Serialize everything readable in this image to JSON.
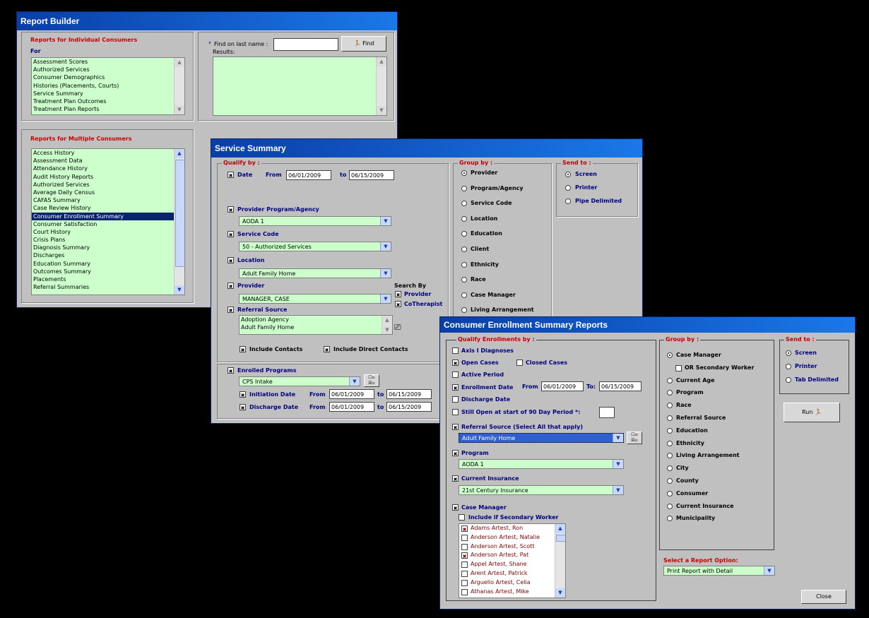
{
  "report_builder": {
    "title": "Report Builder",
    "individual": {
      "heading": "Reports for Individual Consumers",
      "for_label": "For",
      "items": [
        "Assessment Scores",
        "Authorized Services",
        "Consumer Demographics",
        "Histories (Placements, Courts)",
        "Service Summary",
        "Treatment Plan Outcomes",
        "Treatment Plan Reports"
      ]
    },
    "find": {
      "label": "Find on last name :",
      "value": "",
      "button": "Find",
      "results_label": "Results:"
    },
    "multiple": {
      "heading": "Reports for Multiple Consumers",
      "items": [
        "Access History",
        "Assessment Data",
        "Attendance History",
        "Audit History Reports",
        "Authorized Services",
        "Average Daily Census",
        "CAFAS Summary",
        "Case Review History",
        "Consumer Enrollment Summary",
        "Consumer Satisfaction",
        "Court History",
        "Crisis Plans",
        "Diagnosis Summary",
        "Discharges",
        "Education Summary",
        "Outcomes Summary",
        "Placements",
        "Referral Summaries"
      ],
      "selected": "Consumer Enrollment Summary"
    }
  },
  "service_summary": {
    "title": "Service Summary",
    "qualify_label": "Qualify by :",
    "date_label": "Date",
    "from_label": "From",
    "to_label": "to",
    "date_from": "06/01/2009",
    "date_to": "06/15/2009",
    "provider_program_label": "Provider Program/Agency",
    "provider_program_value": "AODA 1",
    "service_code_label": "Service Code",
    "service_code_value": "50 - Authorized Services",
    "location_label": "Location",
    "location_value": "Adult Family Home",
    "provider_label": "Provider",
    "provider_value": "MANAGER, CASE",
    "search_by_label": "Search By",
    "search_by_provider": "Provider",
    "search_by_cotherapist": "CoTherapist",
    "referral_label": "Referral Source",
    "referral_items": [
      "Adoption Agency",
      "Adult Family Home"
    ],
    "include_contacts": "Include Contacts",
    "include_direct_contacts": "Include Direct Contacts",
    "enrolled_label": "Enrolled Programs",
    "enrolled_value": "CPS Intake",
    "initiation_label": "Initiation Date",
    "initiation_from": "06/01/2009",
    "initiation_to": "06/15/2009",
    "discharge_label": "Discharge Date",
    "discharge_from": "06/01/2009",
    "discharge_to": "06/15/2009",
    "from_cap": "From",
    "group_label": "Group by :",
    "group_items": [
      "Provider",
      "Program/Agency",
      "Service Code",
      "Location",
      "Education",
      "Client",
      "Ethnicity",
      "Race",
      "Case Manager",
      "Living Arrangement"
    ],
    "send_label": "Send to :",
    "send_items": [
      "Screen",
      "Printer",
      "Pipe Delimited"
    ]
  },
  "enrollment": {
    "title": "Consumer Enrollment Summary Reports",
    "qualify_label": "Qualify Enrollments by :",
    "axis": "Axis I Diagnoses",
    "open_cases": "Open Cases",
    "closed_cases": "Closed Cases",
    "active_period": "Active Period",
    "enrollment_date": "Enrollment Date",
    "from_label": "From",
    "to_label": "To:",
    "enroll_from": "06/01/2009",
    "enroll_to": "06/15/2009",
    "discharge_date": "Discharge Date",
    "still_open": "Still Open at start of 90 Day Period *:",
    "still_open_value": "",
    "referral_label": "Referral Source (Select All that apply)",
    "referral_value": "Adult Family Home",
    "program_label": "Program",
    "program_value": "AODA 1",
    "insurance_label": "Current Insurance",
    "insurance_value": "21st Century Insurance",
    "case_manager_label": "Case Manager",
    "include_secondary": "Include if Secondary Worker",
    "managers": [
      {
        "name": "Adams Artest, Ron",
        "checked": true
      },
      {
        "name": "Anderson Artest, Natalie",
        "checked": false
      },
      {
        "name": "Anderson Artest, Scott",
        "checked": false
      },
      {
        "name": "Anderson Artest, Pat",
        "checked": true
      },
      {
        "name": "Appel Artest, Shane",
        "checked": false
      },
      {
        "name": "Arent Artest, Patrick",
        "checked": false
      },
      {
        "name": "Arguello Artest, Celia",
        "checked": false
      },
      {
        "name": "Athanas Artest, Mike",
        "checked": false
      }
    ],
    "group_label": "Group by :",
    "group_items": [
      "Case Manager",
      "OR Secondary Worker",
      "Current Age",
      "Program",
      "Race",
      "Referral Source",
      "Education",
      "Ethnicity",
      "Living Arrangement",
      "City",
      "County",
      "Consumer",
      "Current Insurance",
      "Municipality"
    ],
    "send_label": "Send to :",
    "send_items": [
      "Screen",
      "Printer",
      "Tab Delimited"
    ],
    "run_label": "Run",
    "report_option_label": "Select a Report Option:",
    "report_option_value": "Print Report with Detail",
    "close_label": "Close"
  }
}
